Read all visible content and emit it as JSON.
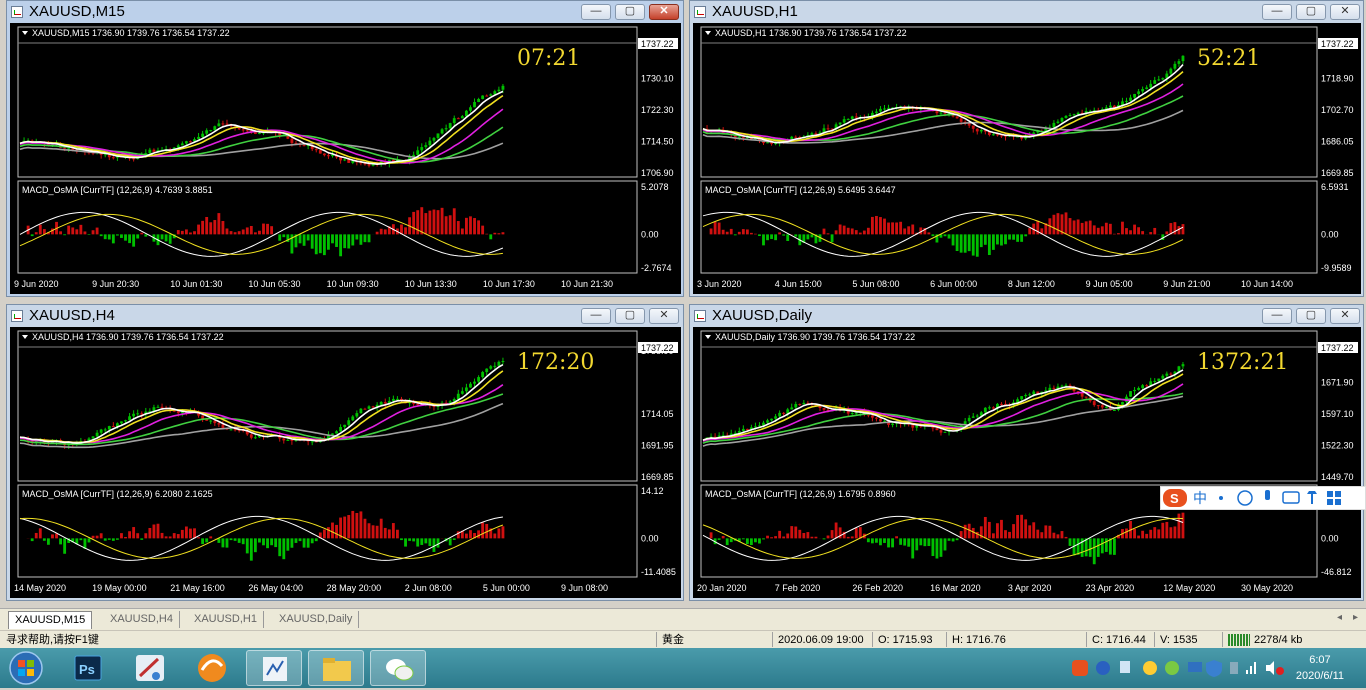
{
  "windows": [
    {
      "id": "m15",
      "title": "XAUUSD,M15",
      "label": "XAUUSD,M15  1736.90 1739.76 1736.54 1737.22",
      "timer": "07:21",
      "price_levels": [
        "1737.22",
        "1730.10",
        "1722.30",
        "1714.50",
        "1706.90"
      ],
      "current_price": "1737.22",
      "macd_label": "MACD_OsMA [CurrTF] (12,26,9) 4.7639 3.8851",
      "macd_levels": [
        "5.2078",
        "0.00",
        "-2.7674"
      ],
      "time_labels": [
        "9 Jun 2020",
        "9 Jun 20:30",
        "10 Jun 01:30",
        "10 Jun 05:30",
        "10 Jun 09:30",
        "10 Jun 13:30",
        "10 Jun 17:30",
        "10 Jun 21:30"
      ]
    },
    {
      "id": "h1",
      "title": "XAUUSD,H1",
      "label": "XAUUSD,H1  1736.90 1739.76 1736.54 1737.22",
      "timer": "52:21",
      "price_levels": [
        "1737.22",
        "1718.90",
        "1702.70",
        "1686.05",
        "1669.85"
      ],
      "current_price": "1737.22",
      "macd_label": "MACD_OsMA [CurrTF] (12,26,9) 5.6495 3.6447",
      "macd_levels": [
        "6.5931",
        "0.00",
        "-9.9589"
      ],
      "time_labels": [
        "3 Jun 2020",
        "4 Jun 15:00",
        "5 Jun 08:00",
        "6 Jun 00:00",
        "8 Jun 12:00",
        "9 Jun 05:00",
        "9 Jun 21:00",
        "10 Jun 14:00"
      ]
    },
    {
      "id": "h4",
      "title": "XAUUSD,H4",
      "label": "XAUUSD,H4  1736.90 1739.76 1736.54 1737.22",
      "timer": "172:20",
      "price_levels": [
        "1758.90",
        "1737.22",
        "1714.05",
        "1691.95",
        "1669.85"
      ],
      "current_price": "1737.22",
      "macd_label": "MACD_OsMA [CurrTF] (12,26,9) 6.2080 2.1625",
      "macd_levels": [
        "14.12",
        "0.00",
        "-11.4085"
      ],
      "time_labels": [
        "14 May 2020",
        "19 May 00:00",
        "21 May 16:00",
        "26 May 04:00",
        "28 May 20:00",
        "2 Jun 08:00",
        "5 Jun 00:00",
        "9 Jun 08:00"
      ]
    },
    {
      "id": "d1",
      "title": "XAUUSD,Daily",
      "label": "XAUUSD,Daily  1736.90 1739.76 1736.54 1737.22",
      "timer": "1372:21",
      "price_levels": [
        "1737.22",
        "1671.90",
        "1597.10",
        "1522.30",
        "1449.70"
      ],
      "current_price": "1737.22",
      "macd_label": "MACD_OsMA [CurrTF] (12,26,9) 1.6795 0.8960",
      "macd_levels": [
        "0.00",
        "-46.812"
      ],
      "time_labels": [
        "20 Jan 2020",
        "7 Feb 2020",
        "26 Feb 2020",
        "16 Mar 2020",
        "3 Apr 2020",
        "23 Apr 2020",
        "12 May 2020",
        "30 May 2020"
      ]
    }
  ],
  "window_buttons": {
    "minimize": "—",
    "maximize": "▢",
    "close": "✕"
  },
  "tabs": [
    "XAUUSD,M15",
    "XAUUSD,H4",
    "XAUUSD,H1",
    "XAUUSD,Daily"
  ],
  "status": {
    "help": "寻求帮助,请按F1键",
    "symbol": "黄金",
    "datetime": "2020.06.09 19:00",
    "open": "O: 1715.93",
    "high": "H: 1716.76",
    "close": "C: 1716.44",
    "volume": "V: 1535",
    "traffic": "2278/4 kb"
  },
  "ime": {
    "label": "中"
  },
  "clock": {
    "time": "6:07",
    "date": "2020/6/11"
  },
  "colors": {
    "bull": "#00c000",
    "bear": "#d01010",
    "ma_white": "#ffffff",
    "ma_yellow": "#f0e020",
    "ma_magenta": "#e020e0",
    "ma_green": "#40d040",
    "ma_gray": "#a0a0a0",
    "timer": "#f2d830"
  }
}
